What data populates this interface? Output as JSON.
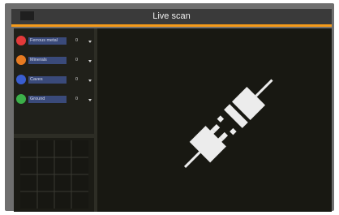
{
  "app": {
    "title": "Live scan",
    "battery_icon": "battery-icon",
    "battery_color": "#1fb04a",
    "accent_color": "#f59a19"
  },
  "targets": [
    {
      "label": "Ferrous metal",
      "value": "0",
      "color": "#e23a3a"
    },
    {
      "label": "Minerals",
      "value": "0",
      "color": "#e67a22"
    },
    {
      "label": "Caves",
      "value": "0",
      "color": "#3a5ed0"
    },
    {
      "label": "Ground",
      "value": "0",
      "color": "#3cb04a"
    }
  ],
  "scan": {
    "icon": "disconnected-plug-icon"
  }
}
